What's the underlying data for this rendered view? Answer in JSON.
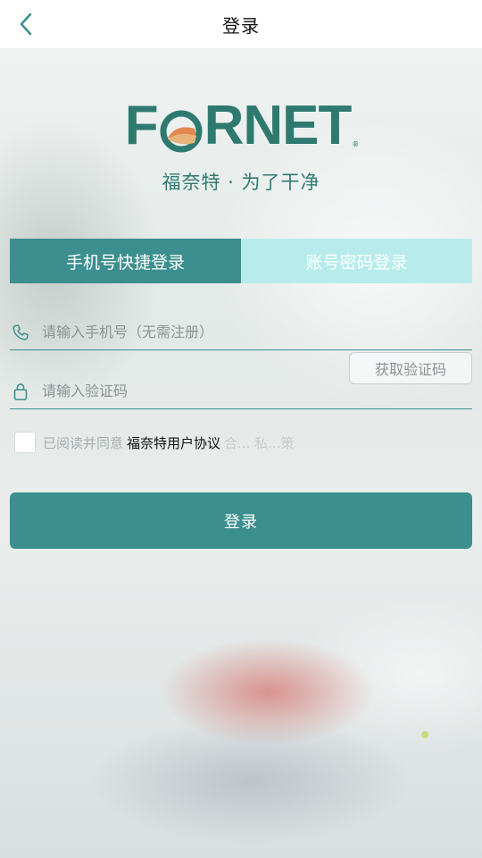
{
  "header": {
    "title": "登录"
  },
  "brand": {
    "logo_text_left": "F",
    "logo_text_right": "RNET",
    "slogan": "福奈特 · 为了干净"
  },
  "tabs": [
    {
      "label": "手机号快捷登录",
      "active": true
    },
    {
      "label": "账号密码登录",
      "active": false
    }
  ],
  "form": {
    "phone_placeholder": "请输入手机号（无需注册）",
    "code_placeholder": "请输入验证码",
    "get_code_label": "获取验证码"
  },
  "agreement": {
    "prefix": "已阅读并同意",
    "link": "福奈特用户协议",
    "suffix": "合... 私...策"
  },
  "login_button": "登录",
  "colors": {
    "accent": "#3b8f8e",
    "tab_inactive": "#b8ecec",
    "brand": "#2f7a70"
  },
  "icons": {
    "back": "chevron-left-icon",
    "phone": "phone-icon",
    "lock": "lock-icon"
  }
}
